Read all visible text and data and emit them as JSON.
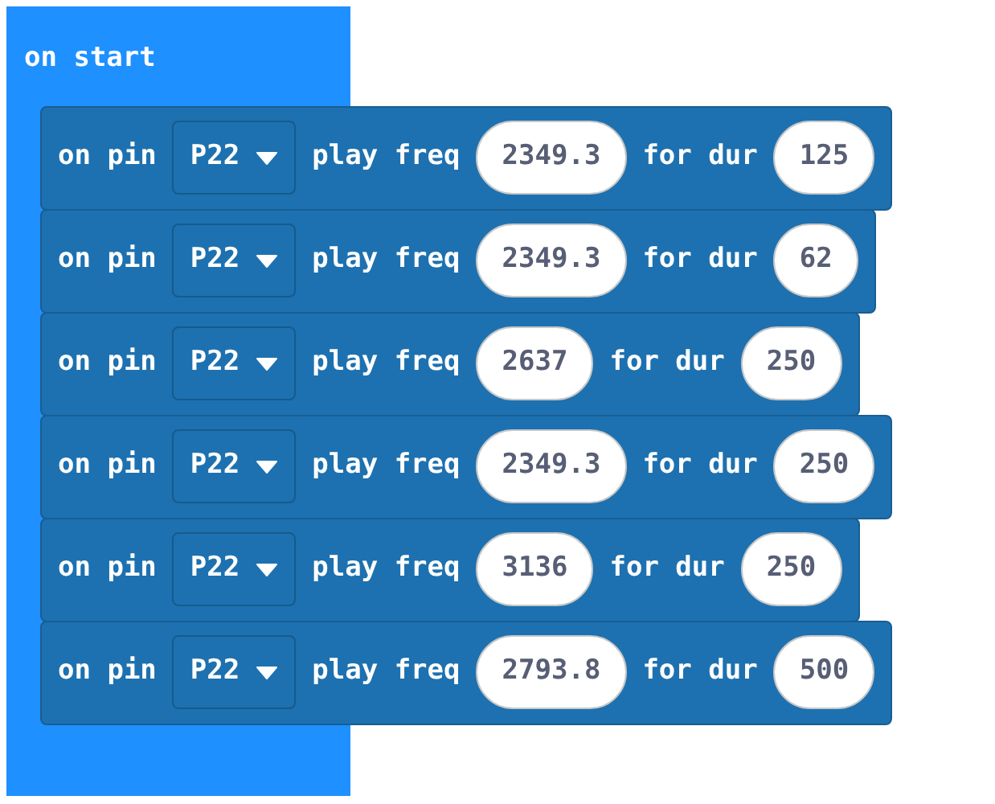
{
  "event_block": {
    "label": "on start"
  },
  "blocks": [
    {
      "pin_label": "on pin",
      "pin": "P22",
      "freq_label": "play freq",
      "freq": "2349.3",
      "dur_label": "for dur",
      "dur": "125"
    },
    {
      "pin_label": "on pin",
      "pin": "P22",
      "freq_label": "play freq",
      "freq": "2349.3",
      "dur_label": "for dur",
      "dur": "62"
    },
    {
      "pin_label": "on pin",
      "pin": "P22",
      "freq_label": "play freq",
      "freq": "2637",
      "dur_label": "for dur",
      "dur": "250"
    },
    {
      "pin_label": "on pin",
      "pin": "P22",
      "freq_label": "play freq",
      "freq": "2349.3",
      "dur_label": "for dur",
      "dur": "250"
    },
    {
      "pin_label": "on pin",
      "pin": "P22",
      "freq_label": "play freq",
      "freq": "3136",
      "dur_label": "for dur",
      "dur": "250"
    },
    {
      "pin_label": "on pin",
      "pin": "P22",
      "freq_label": "play freq",
      "freq": "2793.8",
      "dur_label": "for dur",
      "dur": "500"
    }
  ]
}
